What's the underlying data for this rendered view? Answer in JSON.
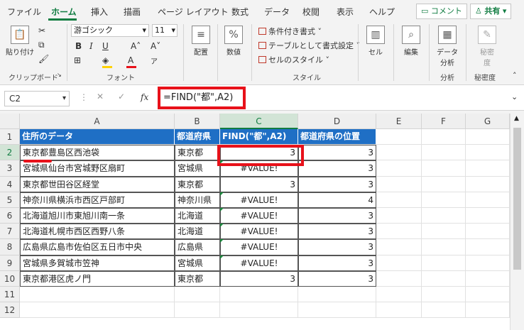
{
  "tabs": [
    "ファイル",
    "ホーム",
    "挿入",
    "描画",
    "ページ レイアウト",
    "数式",
    "データ",
    "校閲",
    "表示",
    "ヘルプ"
  ],
  "top_buttons": {
    "comment": "コメント",
    "share": "共有"
  },
  "ribbon": {
    "clipboard": {
      "paste": "貼り付け",
      "label": "クリップボード"
    },
    "font": {
      "name": "游ゴシック",
      "size": "11",
      "label": "フォント"
    },
    "alignment": {
      "label": "配置"
    },
    "number": {
      "label": "数値"
    },
    "styles": {
      "cond": "条件付き書式",
      "table": "テーブルとして書式設定",
      "cell": "セルのスタイル",
      "label": "スタイル"
    },
    "cells": {
      "label": "セル"
    },
    "editing": {
      "label": "編集"
    },
    "analysis": {
      "btn1": "データ",
      "btn2": "分析",
      "label": "分析"
    },
    "sensitivity": {
      "btn1": "秘密",
      "btn2": "度",
      "label": "秘密度"
    }
  },
  "formula_bar": {
    "name_box": "C2",
    "fx": "fx",
    "formula": "=FIND(\"都\",A2)"
  },
  "columns": [
    "A",
    "B",
    "C",
    "D",
    "E",
    "F",
    "G"
  ],
  "rows": [
    "1",
    "2",
    "3",
    "4",
    "5",
    "6",
    "7",
    "8",
    "9",
    "10",
    "11",
    "12"
  ],
  "headers": [
    "住所のデータ",
    "都道府県",
    "FIND(\"都\",A2)",
    "都道府県の位置"
  ],
  "data": [
    {
      "a": "東京都豊島区西池袋",
      "b": "東京都",
      "c": "3",
      "d": "3"
    },
    {
      "a": "宮城県仙台市宮城野区扇町",
      "b": "宮城県",
      "c": "#VALUE!",
      "d": "3"
    },
    {
      "a": "東京都世田谷区経堂",
      "b": "東京都",
      "c": "3",
      "d": "3"
    },
    {
      "a": "神奈川県横浜市西区戸部町",
      "b": "神奈川県",
      "c": "#VALUE!",
      "d": "4"
    },
    {
      "a": "北海道旭川市東旭川南一条",
      "b": "北海道",
      "c": "#VALUE!",
      "d": "3"
    },
    {
      "a": "北海道札幌市西区西野八条",
      "b": "北海道",
      "c": "#VALUE!",
      "d": "3"
    },
    {
      "a": "広島県広島市佐伯区五日市中央",
      "b": "広島県",
      "c": "#VALUE!",
      "d": "3"
    },
    {
      "a": "宮城県多賀城市笠神",
      "b": "宮城県",
      "c": "#VALUE!",
      "d": "3"
    },
    {
      "a": "東京都港区虎ノ門",
      "b": "東京都",
      "c": "3",
      "d": "3"
    }
  ]
}
